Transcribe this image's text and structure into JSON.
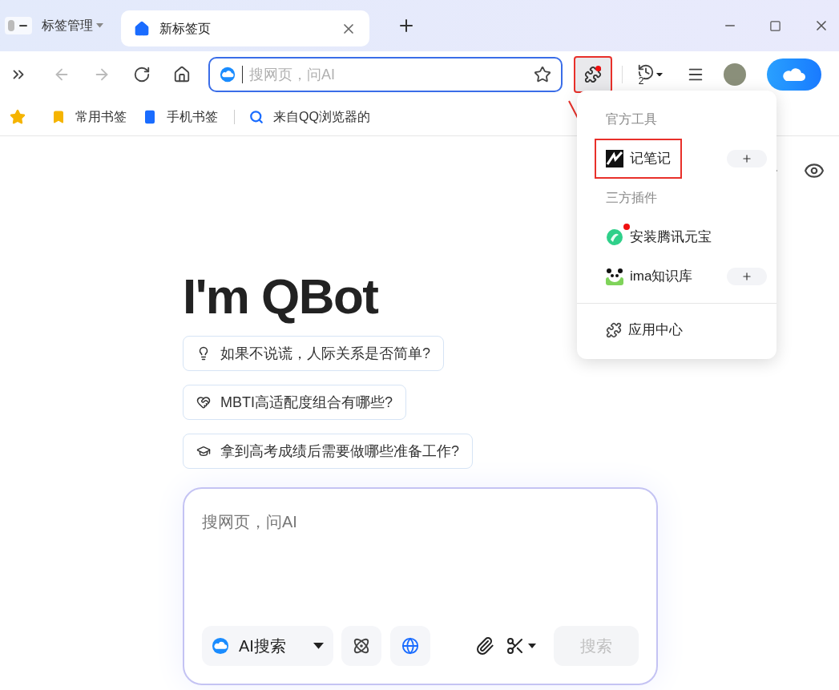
{
  "tab_bar": {
    "tab_manager": "标签管理",
    "tabs": [
      {
        "title": "新标签页",
        "selected": true
      }
    ]
  },
  "toolbar": {
    "address_placeholder": "搜网页，问AI",
    "history_count": "2",
    "extension_badge": true
  },
  "bookmarks": [
    {
      "label": "常用书签",
      "kind": "star"
    },
    {
      "label": "手机书签",
      "kind": "phone"
    },
    {
      "label": "来自QQ浏览器的",
      "kind": "qq"
    }
  ],
  "extension_menu": {
    "sections": [
      {
        "heading": "官方工具",
        "items": [
          {
            "label": "记笔记",
            "kind": "notes",
            "badge": false,
            "pin": true,
            "highlighted": true
          }
        ]
      },
      {
        "heading": "三方插件",
        "items": [
          {
            "label": "安装腾讯元宝",
            "kind": "yuanbao",
            "badge": true,
            "pin": false,
            "highlighted": false
          },
          {
            "label": "ima知识库",
            "kind": "ima",
            "badge": false,
            "pin": true,
            "highlighted": false
          }
        ]
      }
    ],
    "footer": "应用中心"
  },
  "headline": "I'm QBot",
  "suggestions": [
    {
      "text": "如果不说谎，人际关系是否简单?",
      "kind": "bulb"
    },
    {
      "text": "MBTI高适配度组合有哪些?",
      "kind": "heart"
    },
    {
      "text": "拿到高考成绩后需要做哪些准备工作?",
      "kind": "cap"
    }
  ],
  "chat_box": {
    "placeholder": "搜网页，问AI",
    "mode": "AI搜索",
    "search_button": "搜索",
    "search_disabled": true,
    "web_on": true
  }
}
